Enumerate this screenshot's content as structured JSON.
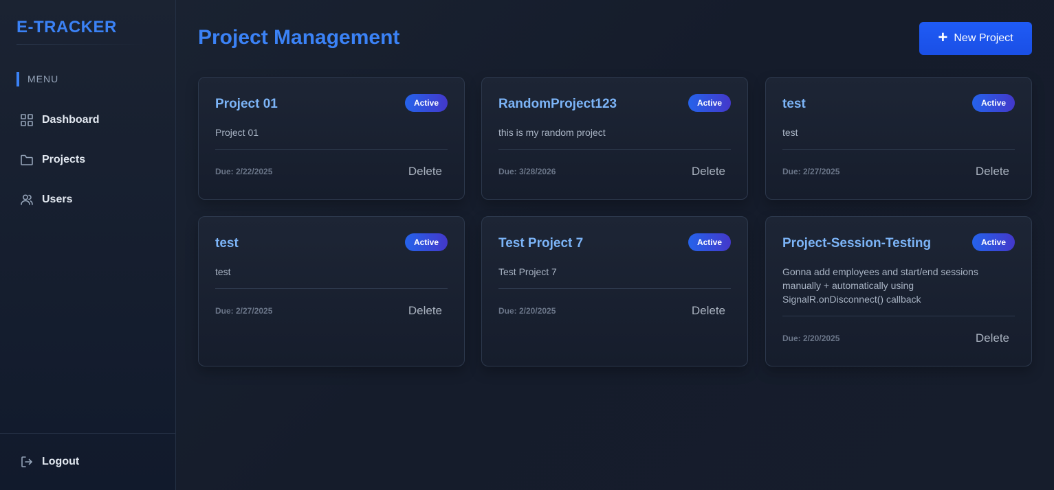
{
  "sidebar": {
    "brand": "E-TRACKER",
    "menu_heading": "MENU",
    "items": [
      {
        "label": "Dashboard",
        "icon": "grid-icon"
      },
      {
        "label": "Projects",
        "icon": "folder-icon"
      },
      {
        "label": "Users",
        "icon": "users-icon"
      }
    ],
    "logout": {
      "label": "Logout",
      "icon": "logout-icon"
    }
  },
  "header": {
    "title": "Project Management",
    "new_button": "New Project"
  },
  "projects": [
    {
      "title": "Project 01",
      "status": "Active",
      "description": "Project 01",
      "due": "Due: 2/22/2025",
      "delete": "Delete"
    },
    {
      "title": "RandomProject123",
      "status": "Active",
      "description": "this is my random project",
      "due": "Due: 3/28/2026",
      "delete": "Delete"
    },
    {
      "title": "test",
      "status": "Active",
      "description": "test",
      "due": "Due: 2/27/2025",
      "delete": "Delete"
    },
    {
      "title": "test",
      "status": "Active",
      "description": "test",
      "due": "Due: 2/27/2025",
      "delete": "Delete"
    },
    {
      "title": "Test Project 7",
      "status": "Active",
      "description": "Test Project 7",
      "due": "Due: 2/20/2025",
      "delete": "Delete"
    },
    {
      "title": "Project-Session-Testing",
      "status": "Active",
      "description": "Gonna add employees and start/end sessions manually + automatically using SignalR.onDisconnect() callback",
      "due": "Due: 2/20/2025",
      "delete": "Delete"
    }
  ],
  "colors": {
    "accent": "#3b82f6",
    "badge_start": "#2563eb",
    "badge_end": "#4338ca",
    "card_title": "#7cb4f7"
  }
}
